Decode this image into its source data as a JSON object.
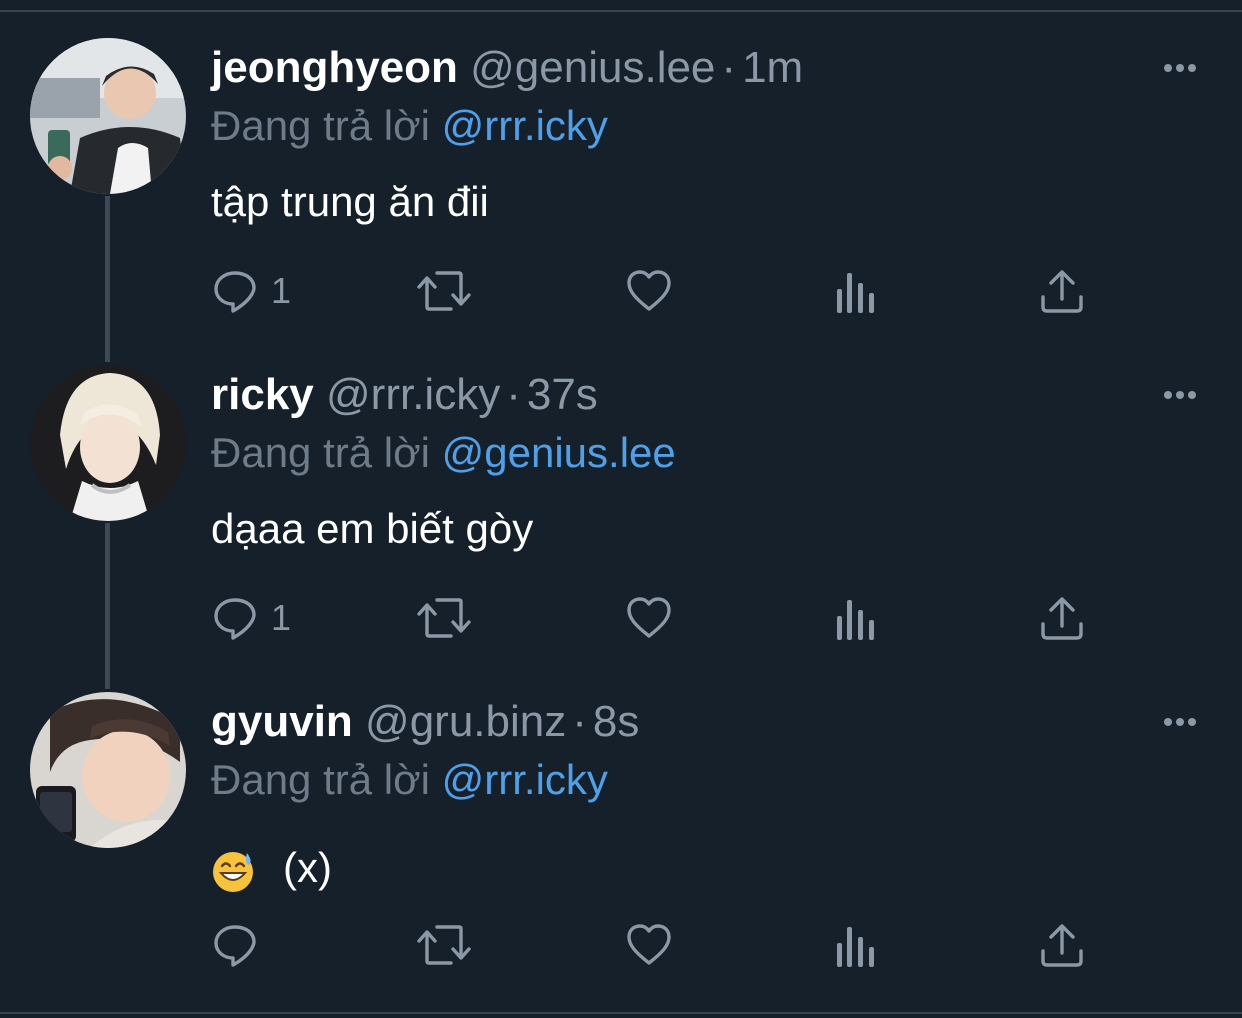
{
  "colors": {
    "background": "#15202b",
    "secondary_text": "#8b98a5",
    "mention": "#4fa0e8",
    "thread_line": "#3d4a55"
  },
  "tweets": [
    {
      "display_name": "jeonghyeon",
      "handle": "@genius.lee",
      "separator": "·",
      "time": "1m",
      "replying_label": "Đang trả lời",
      "replying_to": "@rrr.icky",
      "text": "tập trung ăn đii",
      "reply_count": "1",
      "icons": [
        "reply-icon",
        "retweet-icon",
        "like-icon",
        "views-icon",
        "share-icon",
        "more-icon"
      ]
    },
    {
      "display_name": "ricky",
      "handle": "@rrr.icky",
      "separator": "·",
      "time": "37s",
      "replying_label": "Đang trả lời",
      "replying_to": "@genius.lee",
      "text": "dạaa em biết gòy",
      "reply_count": "1",
      "icons": [
        "reply-icon",
        "retweet-icon",
        "like-icon",
        "views-icon",
        "share-icon",
        "more-icon"
      ]
    },
    {
      "display_name": "gyuvin",
      "handle": "@gru.binz",
      "separator": "·",
      "time": "8s",
      "replying_label": "Đang trả lời",
      "replying_to": "@rrr.icky",
      "text": "(x)",
      "emoji": "grinning-face-with-sweat-emoji",
      "reply_count": "",
      "icons": [
        "reply-icon",
        "retweet-icon",
        "like-icon",
        "views-icon",
        "share-icon",
        "more-icon"
      ]
    }
  ]
}
